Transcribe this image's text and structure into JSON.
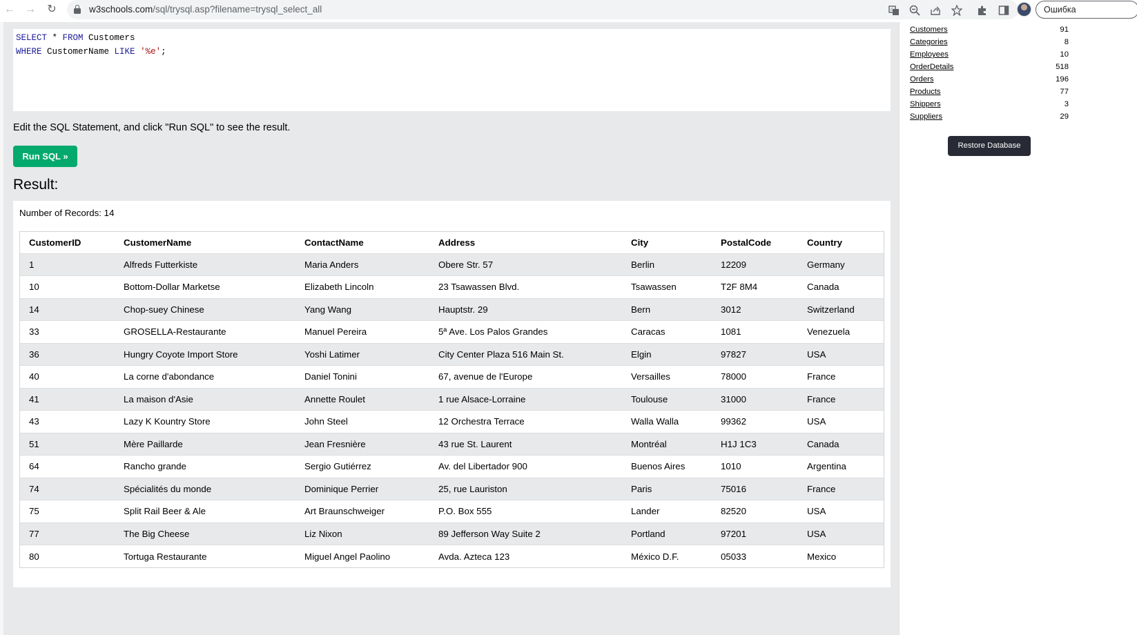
{
  "browser": {
    "url_domain": "w3schools.com",
    "url_path": "/sql/trysql.asp?filename=trysql_select_all",
    "error_label": "Ошибка"
  },
  "editor": {
    "line1": {
      "kw1": "SELECT",
      "rest1": " * ",
      "kw2": "FROM",
      "rest2": " Customers"
    },
    "line2": {
      "kw1": "WHERE",
      "rest1": " CustomerName ",
      "kw2": "LIKE",
      "rest2": " ",
      "str": "'%e'",
      "rest3": ";"
    }
  },
  "instruction": "Edit the SQL Statement, and click \"Run SQL\" to see the result.",
  "run_button": "Run SQL »",
  "result_heading": "Result:",
  "record_count": "Number of Records: 14",
  "table": {
    "headers": [
      "CustomerID",
      "CustomerName",
      "ContactName",
      "Address",
      "City",
      "PostalCode",
      "Country"
    ],
    "rows": [
      [
        "1",
        "Alfreds Futterkiste",
        "Maria Anders",
        "Obere Str. 57",
        "Berlin",
        "12209",
        "Germany"
      ],
      [
        "10",
        "Bottom-Dollar Marketse",
        "Elizabeth Lincoln",
        "23 Tsawassen Blvd.",
        "Tsawassen",
        "T2F 8M4",
        "Canada"
      ],
      [
        "14",
        "Chop-suey Chinese",
        "Yang Wang",
        "Hauptstr. 29",
        "Bern",
        "3012",
        "Switzerland"
      ],
      [
        "33",
        "GROSELLA-Restaurante",
        "Manuel Pereira",
        "5ª Ave. Los Palos Grandes",
        "Caracas",
        "1081",
        "Venezuela"
      ],
      [
        "36",
        "Hungry Coyote Import Store",
        "Yoshi Latimer",
        "City Center Plaza 516 Main St.",
        "Elgin",
        "97827",
        "USA"
      ],
      [
        "40",
        "La corne d'abondance",
        "Daniel Tonini",
        "67, avenue de l'Europe",
        "Versailles",
        "78000",
        "France"
      ],
      [
        "41",
        "La maison d'Asie",
        "Annette Roulet",
        "1 rue Alsace-Lorraine",
        "Toulouse",
        "31000",
        "France"
      ],
      [
        "43",
        "Lazy K Kountry Store",
        "John Steel",
        "12 Orchestra Terrace",
        "Walla Walla",
        "99362",
        "USA"
      ],
      [
        "51",
        "Mère Paillarde",
        "Jean Fresnière",
        "43 rue St. Laurent",
        "Montréal",
        "H1J 1C3",
        "Canada"
      ],
      [
        "64",
        "Rancho grande",
        "Sergio Gutiérrez",
        "Av. del Libertador 900",
        "Buenos Aires",
        "1010",
        "Argentina"
      ],
      [
        "74",
        "Spécialités du monde",
        "Dominique Perrier",
        "25, rue Lauriston",
        "Paris",
        "75016",
        "France"
      ],
      [
        "75",
        "Split Rail Beer & Ale",
        "Art Braunschweiger",
        "P.O. Box 555",
        "Lander",
        "82520",
        "USA"
      ],
      [
        "77",
        "The Big Cheese",
        "Liz Nixon",
        "89 Jefferson Way Suite 2",
        "Portland",
        "97201",
        "USA"
      ],
      [
        "80",
        "Tortuga Restaurante",
        "Miguel Angel Paolino",
        "Avda. Azteca 123",
        "México D.F.",
        "05033",
        "Mexico"
      ]
    ]
  },
  "sidebar": {
    "tables": [
      {
        "name": "Customers",
        "count": "91"
      },
      {
        "name": "Categories",
        "count": "8"
      },
      {
        "name": "Employees",
        "count": "10"
      },
      {
        "name": "OrderDetails",
        "count": "518"
      },
      {
        "name": "Orders",
        "count": "196"
      },
      {
        "name": "Products",
        "count": "77"
      },
      {
        "name": "Shippers",
        "count": "3"
      },
      {
        "name": "Suppliers",
        "count": "29"
      }
    ],
    "restore_button": "Restore Database"
  },
  "colors": {
    "run_button": "#04aa6d",
    "restore_button": "#282a35",
    "panel_background": "#e7e9eb"
  }
}
